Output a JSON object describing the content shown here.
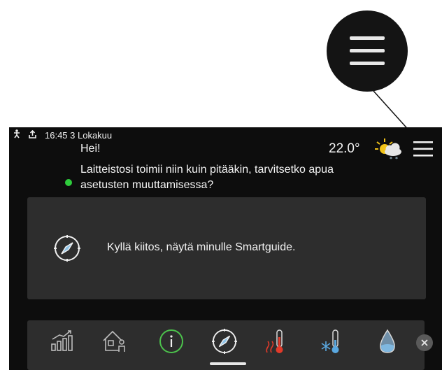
{
  "status_bar": {
    "datetime": "16:45 3 Lokakuu",
    "icons": [
      "person-icon",
      "upload-icon"
    ]
  },
  "header": {
    "greeting": "Hei!",
    "message_line1": "Laitteistosi toimii niin kuin pitääkin, tarvitsetko apua",
    "message_line2": "asetusten muuttamisessa?",
    "temperature": "22.0°",
    "weather_icon": "partly-cloudy-snow-icon",
    "menu_icon": "hamburger-menu-icon"
  },
  "smartguide_card": {
    "text": "Kyllä kiitos, näytä minulle Smartguide.",
    "icon": "compass-icon"
  },
  "navbar": {
    "items": [
      "stats-icon",
      "home-person-icon",
      "info-icon",
      "compass-icon",
      "heating-icon",
      "cooling-icon",
      "water-drop-icon"
    ],
    "close_icon": "close-icon"
  },
  "callout": {
    "icon": "hamburger-menu-icon"
  },
  "colors": {
    "screen_bg": "#0d0d0d",
    "panel_bg": "#2d2d2d",
    "status_green": "#2ecc3c",
    "heating_red": "#e23a2a",
    "cooling_blue": "#5aa8e0",
    "info_green": "#4cc24c"
  }
}
